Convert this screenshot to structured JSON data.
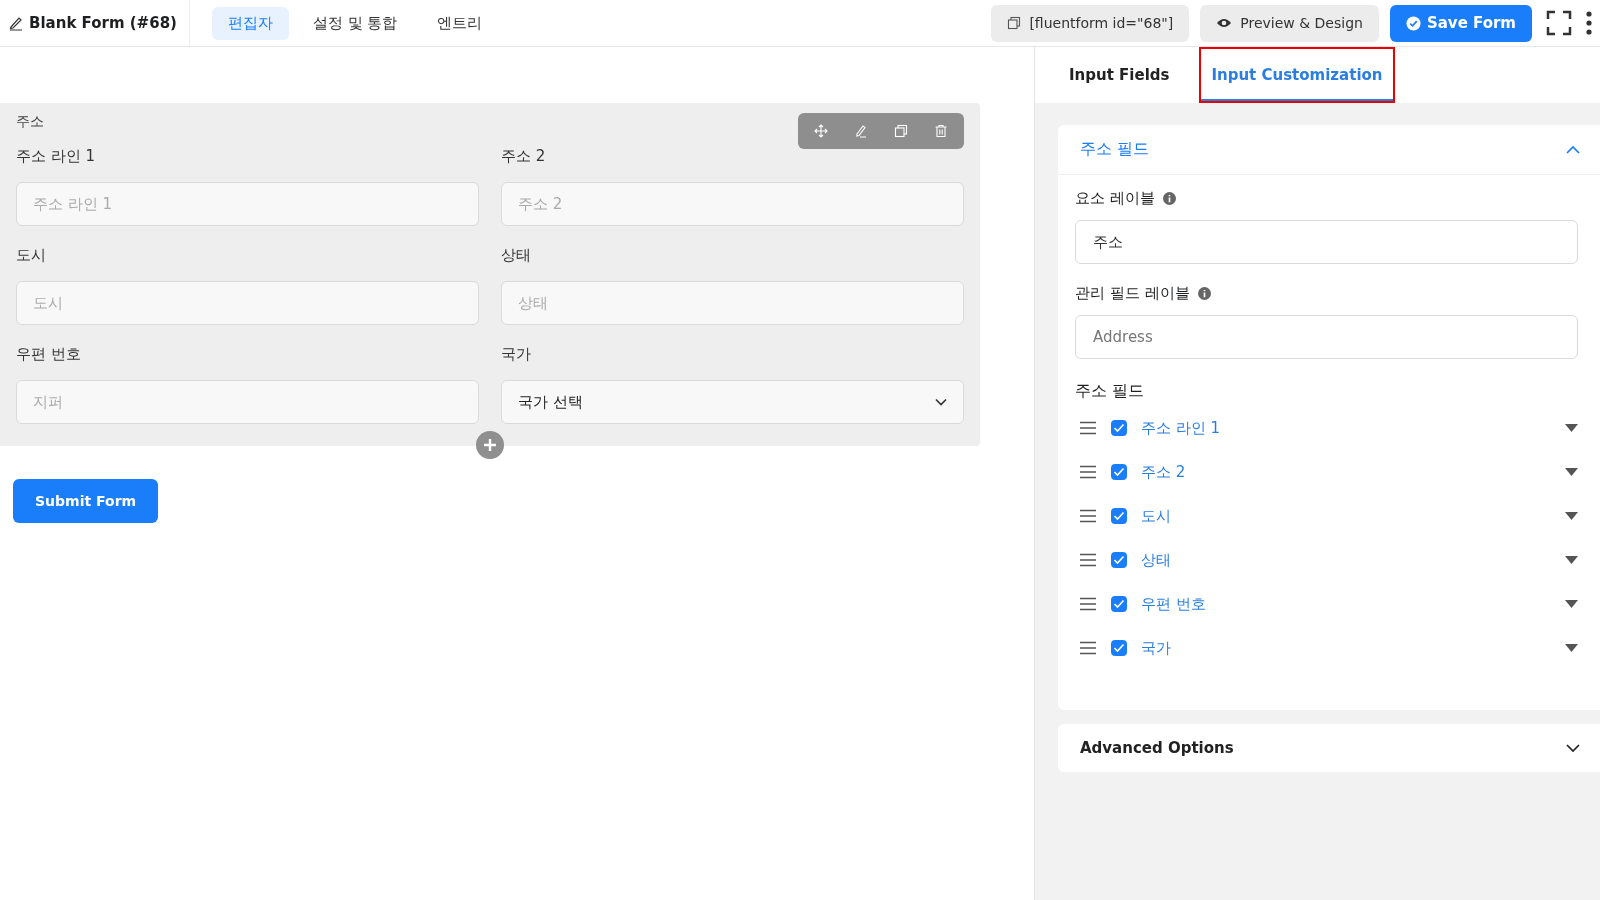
{
  "header": {
    "title": "Blank Form (#68)",
    "tabs": [
      {
        "label": "편집자",
        "selected": true
      },
      {
        "label": "설정 및 통합",
        "selected": false
      },
      {
        "label": "엔트리",
        "selected": false
      }
    ],
    "shortcode": "[fluentform id=\"68\"]",
    "preview": "Preview & Design",
    "save": "Save Form"
  },
  "form": {
    "group_label": "주소",
    "fields": [
      {
        "kind": "input",
        "label": "주소 라인 1",
        "placeholder": "주소 라인 1"
      },
      {
        "kind": "input",
        "label": "주소 2",
        "placeholder": "주소 2"
      },
      {
        "kind": "input",
        "label": "도시",
        "placeholder": "도시"
      },
      {
        "kind": "input",
        "label": "상태",
        "placeholder": "상태"
      },
      {
        "kind": "input",
        "label": "우편 번호",
        "placeholder": "지퍼"
      },
      {
        "kind": "select",
        "label": "국가",
        "value": "국가 선택"
      }
    ],
    "submit": "Submit Form"
  },
  "panel": {
    "tabs": [
      {
        "label": "Input Fields",
        "selected": false,
        "highlighted": false
      },
      {
        "label": "Input Customization",
        "selected": true,
        "highlighted": true
      }
    ],
    "section": {
      "title": "주소 필드",
      "expanded": true,
      "element_label": {
        "label": "요소 레이블",
        "value": "주소"
      },
      "admin_label": {
        "label": "관리 필드 레이블",
        "placeholder": "Address"
      },
      "subfields_title": "주소 필드",
      "subfields": [
        {
          "label": "주소 라인 1",
          "checked": true
        },
        {
          "label": "주소 2",
          "checked": true
        },
        {
          "label": "도시",
          "checked": true
        },
        {
          "label": "상태",
          "checked": true
        },
        {
          "label": "우편 번호",
          "checked": true
        },
        {
          "label": "국가",
          "checked": true
        }
      ]
    },
    "advanced": {
      "title": "Advanced Options",
      "expanded": false
    }
  }
}
